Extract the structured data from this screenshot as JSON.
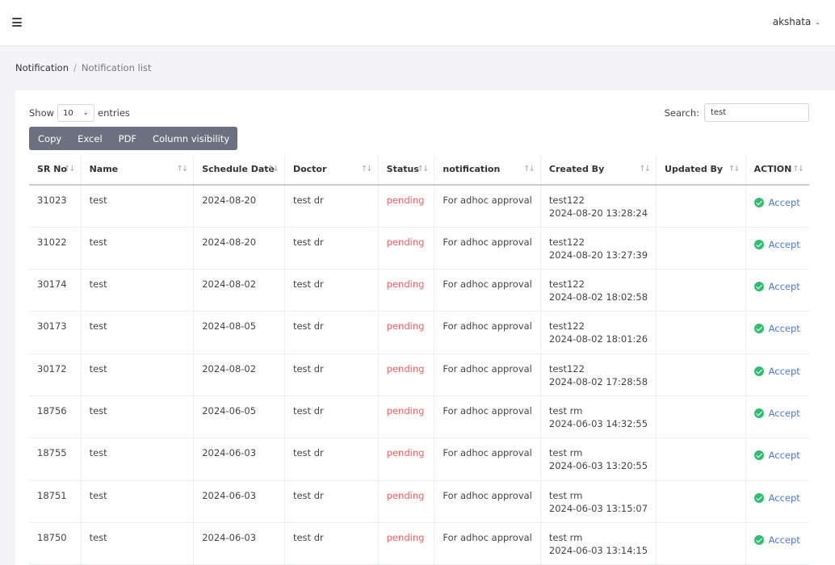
{
  "header": {
    "user_name": "akshata"
  },
  "breadcrumb": {
    "parent": "Notification",
    "current": "Notification list"
  },
  "table_controls": {
    "show_label": "Show",
    "entries_value": "10",
    "entries_label": "entries",
    "search_label": "Search:",
    "search_value": "test"
  },
  "buttons": {
    "copy": "Copy",
    "excel": "Excel",
    "pdf": "PDF",
    "column_visibility": "Column visibility"
  },
  "columns": [
    "SR No",
    "Name",
    "Schedule Date",
    "Doctor",
    "Status",
    "notification",
    "Created By",
    "Updated By",
    "ACTION"
  ],
  "rows": [
    {
      "sr": "31023",
      "name": "test",
      "date": "2024-08-20",
      "doctor": "test dr",
      "status": "pending",
      "notification": "For adhoc approval",
      "created_by": "test122",
      "created_at": "2024-08-20 13:28:24",
      "updated_by": "",
      "action": "Accept"
    },
    {
      "sr": "31022",
      "name": "test",
      "date": "2024-08-20",
      "doctor": "test dr",
      "status": "pending",
      "notification": "For adhoc approval",
      "created_by": "test122",
      "created_at": "2024-08-20 13:27:39",
      "updated_by": "",
      "action": "Accept"
    },
    {
      "sr": "30174",
      "name": "test",
      "date": "2024-08-02",
      "doctor": "test dr",
      "status": "pending",
      "notification": "For adhoc approval",
      "created_by": "test122",
      "created_at": "2024-08-02 18:02:58",
      "updated_by": "",
      "action": "Accept"
    },
    {
      "sr": "30173",
      "name": "test",
      "date": "2024-08-05",
      "doctor": "test dr",
      "status": "pending",
      "notification": "For adhoc approval",
      "created_by": "test122",
      "created_at": "2024-08-02 18:01:26",
      "updated_by": "",
      "action": "Accept"
    },
    {
      "sr": "30172",
      "name": "test",
      "date": "2024-08-02",
      "doctor": "test dr",
      "status": "pending",
      "notification": "For adhoc approval",
      "created_by": "test122",
      "created_at": "2024-08-02 17:28:58",
      "updated_by": "",
      "action": "Accept"
    },
    {
      "sr": "18756",
      "name": "test",
      "date": "2024-06-05",
      "doctor": "test dr",
      "status": "pending",
      "notification": "For adhoc approval",
      "created_by": "test rm",
      "created_at": "2024-06-03 14:32:55",
      "updated_by": "",
      "action": "Accept"
    },
    {
      "sr": "18755",
      "name": "test",
      "date": "2024-06-03",
      "doctor": "test dr",
      "status": "pending",
      "notification": "For adhoc approval",
      "created_by": "test rm",
      "created_at": "2024-06-03 13:20:55",
      "updated_by": "",
      "action": "Accept"
    },
    {
      "sr": "18751",
      "name": "test",
      "date": "2024-06-03",
      "doctor": "test dr",
      "status": "pending",
      "notification": "For adhoc approval",
      "created_by": "test rm",
      "created_at": "2024-06-03 13:15:07",
      "updated_by": "",
      "action": "Accept"
    },
    {
      "sr": "18750",
      "name": "test",
      "date": "2024-06-03",
      "doctor": "test dr",
      "status": "pending",
      "notification": "For adhoc approval",
      "created_by": "test rm",
      "created_at": "2024-06-03 13:14:15",
      "updated_by": "",
      "action": "Accept"
    }
  ],
  "colors": {
    "pending": "#f05f63",
    "accept_link": "#4e79d4",
    "accept_icon": "#2fbf71",
    "button_group": "#6c717f"
  },
  "icons": {
    "menu": "hamburger-icon",
    "user_dropdown": "chevron-down-icon",
    "sort": "sort-icon",
    "accept": "check-circle-icon"
  }
}
